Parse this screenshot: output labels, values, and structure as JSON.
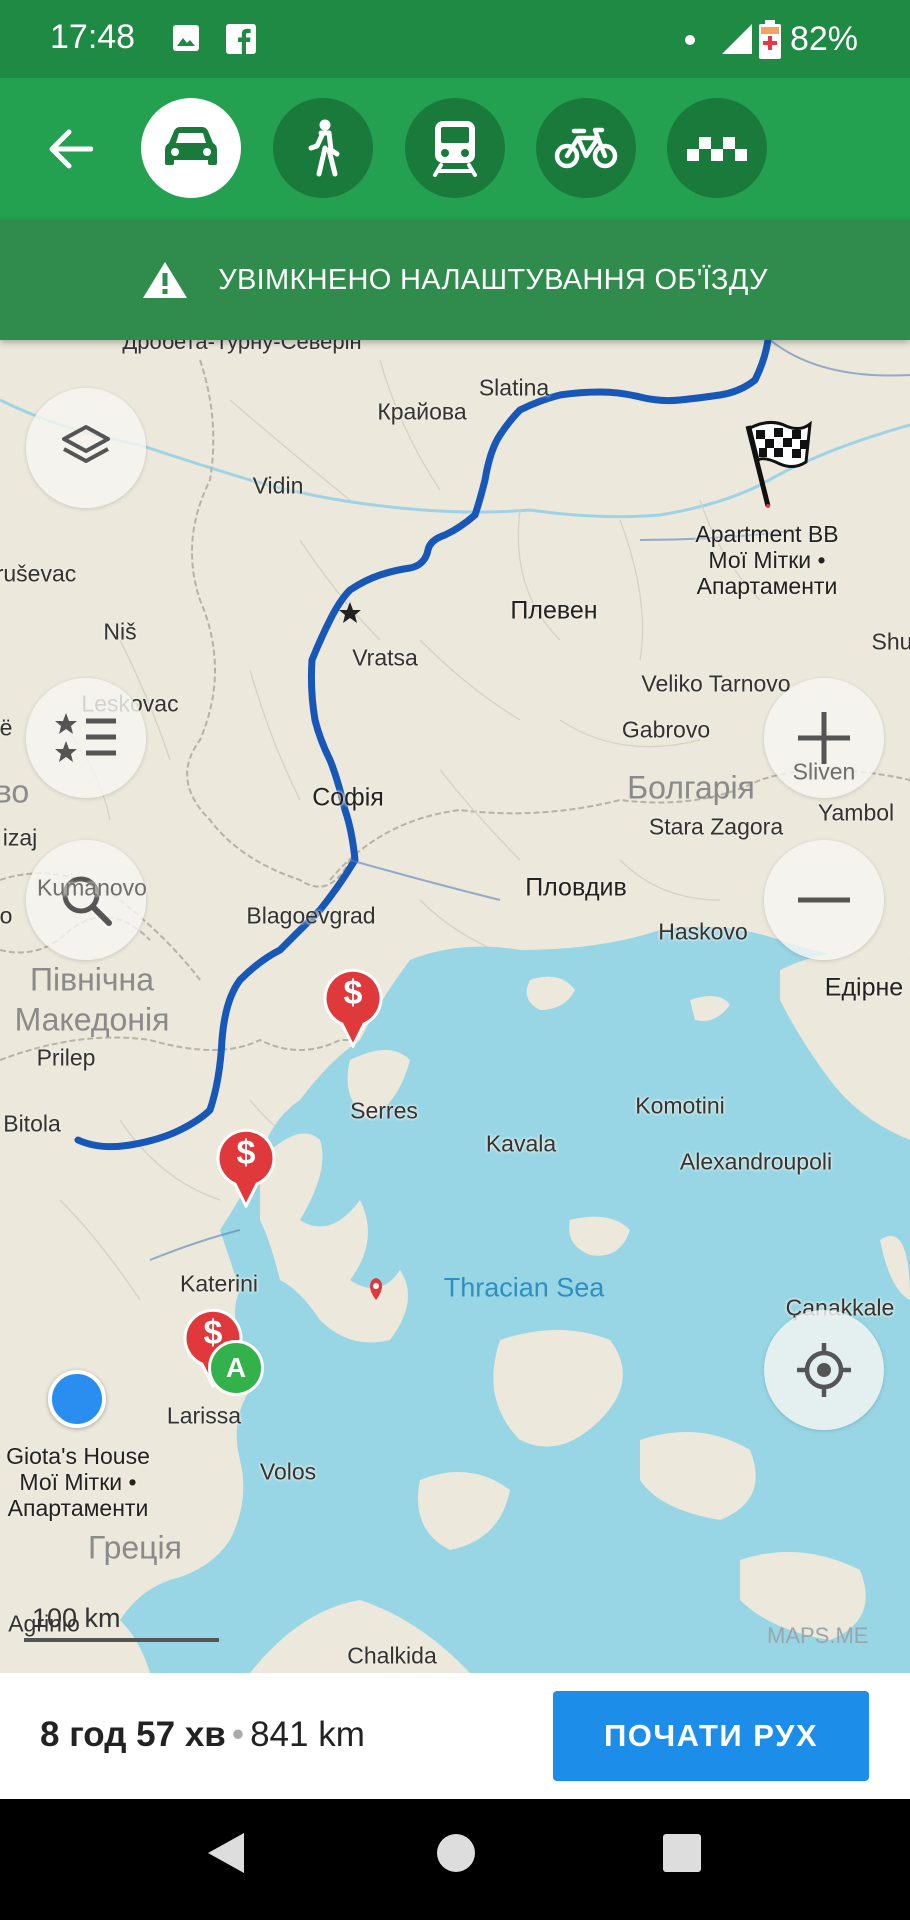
{
  "status_bar": {
    "time": "17:48",
    "battery": "82%",
    "icons": [
      "image-icon",
      "facebook-icon",
      "dot-icon",
      "signal-icon",
      "battery-charging-icon"
    ]
  },
  "modes": [
    {
      "name": "car",
      "icon": "car-icon",
      "active": true
    },
    {
      "name": "walk",
      "icon": "pedestrian-icon",
      "active": false
    },
    {
      "name": "transit",
      "icon": "train-icon",
      "active": false
    },
    {
      "name": "bike",
      "icon": "bicycle-icon",
      "active": false
    },
    {
      "name": "taxi",
      "icon": "taxi-icon",
      "active": false
    }
  ],
  "notice": {
    "text": "УВІМКНЕНО НАЛАШТУВАННЯ ОБ'ЇЗДУ",
    "icon": "warning-icon"
  },
  "map": {
    "labels": {
      "drobeta": "Дробета-Турну-Северін",
      "slatina": "Slatina",
      "krajova": "Крайова",
      "vidin": "Vidin",
      "ruvsevac": "ruševac",
      "nis": "Niš",
      "leskovac": "Leskovac",
      "vratsa": "Vratsa",
      "pleven": "Плевен",
      "veliko": "Veliko Tarnovo",
      "gabrovo": "Gabrovo",
      "sliven": "Sliven",
      "bulgaria": "Болгарія",
      "yambol": "Yambol",
      "sofia": "Софія",
      "stara": "Stara Zagora",
      "plovdiv": "Пловдив",
      "kumanovo": "Kumanovo",
      "blagoevgrad": "Blagoevgrad",
      "haskovo": "Haskovo",
      "north_mk_1": "Північна",
      "north_mk_2": "Македонія",
      "edirne": "Едірне",
      "prilep": "Prilep",
      "serres": "Serres",
      "komotini": "Komotini",
      "bitola": "Bitola",
      "kavala": "Kavala",
      "alexandroupoli": "Alexandroupoli",
      "katerini": "Katerini",
      "thracian": "Thracian Sea",
      "canakkale": "Çanakkale",
      "larissa": "Larissa",
      "volos": "Volos",
      "greece": "Греція",
      "agrinio": "Agrinio",
      "chalkida": "Chalkida",
      "shu": "Shu",
      "edge_o": "o",
      "edge_izaj": "izaj",
      "edge_e": "ë",
      "edge_vo": "во"
    },
    "destination": {
      "line1": "Apartment BB",
      "line2": "Мої Мітки •",
      "line3": "Апартаменти"
    },
    "origin": {
      "line1": "Giota's House",
      "line2": "Мої Мітки •",
      "line3": "Апартаменти"
    },
    "waypoint_label": "A",
    "toll_symbol": "$",
    "scale": "100 km",
    "watermark": "MAPS.ME",
    "colors": {
      "route": "#1757b8",
      "land": "#ece8dc",
      "water": "#98d6e5",
      "toll": "#e0393b",
      "waypoint": "#33b24c",
      "location": "#2a8ef0"
    }
  },
  "route": {
    "duration": "8 год 57 хв",
    "distance": "841 km",
    "start_label": "ПОЧАТИ РУХ"
  }
}
